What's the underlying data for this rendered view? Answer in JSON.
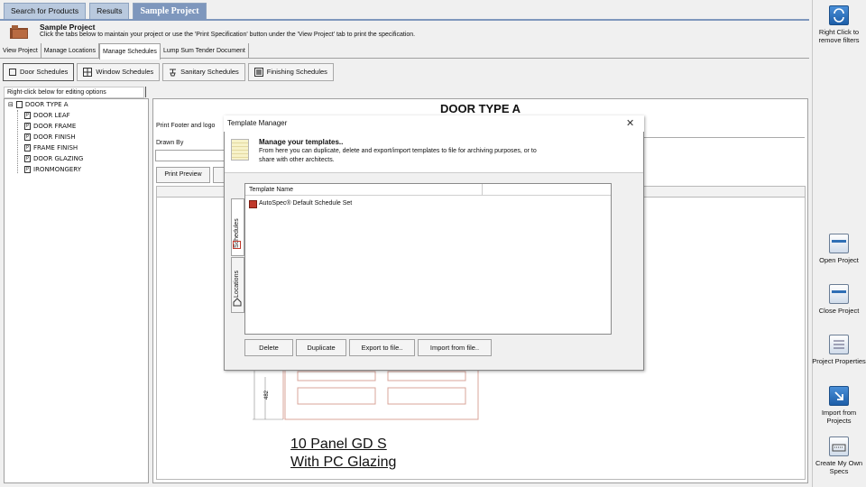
{
  "top_tabs": [
    "Search for Products",
    "Results",
    "Sample Project"
  ],
  "header": {
    "title": "Sample Project",
    "subtitle": "Click the tabs below to maintain your project or use the 'Print Specification' button under the 'View Project' tab to print the specification."
  },
  "sub_tabs": [
    "View Project",
    "Manage Locations",
    "Manage Schedules",
    "Lump Sum Tender Document"
  ],
  "schedule_buttons": [
    "Door Schedules",
    "Window Schedules",
    "Sanitary Schedules",
    "Finishing Schedules"
  ],
  "tree": {
    "hint": "Right-click below for editing options",
    "root": "DOOR TYPE A",
    "children": [
      "DOOR LEAF",
      "DOOR FRAME",
      "DOOR FINISH",
      "FRAME FINISH",
      "DOOR GLAZING",
      "IRONMONGERY"
    ]
  },
  "main": {
    "door_title": "DOOR TYPE A",
    "print_footer_label": "Print Footer and logo",
    "drawn_by_label": "Drawn By",
    "print_preview_label": "Print Preview",
    "dimension_label": "482",
    "caption_line1": "10 Panel GD S",
    "caption_line2": "With PC Glazing"
  },
  "right_panel": {
    "filter_label": "Right Click to remove filters",
    "buttons": [
      "Open Project",
      "Close Project",
      "Project Properties",
      "Import from Projects",
      "Create My Own Specs"
    ]
  },
  "dialog": {
    "title": "Template Manager",
    "close": "✕",
    "heading": "Manage your templates..",
    "desc_line1": "From here you can duplicate, delete and export/import templates to file for archiving purposes, or to",
    "desc_line2": "share with other architects.",
    "side_tabs": [
      "Schedules",
      "Locations"
    ],
    "column_header": "Template Name",
    "rows": [
      "AutoSpec® Default Schedule Set"
    ],
    "buttons": [
      "Delete",
      "Duplicate",
      "Export to file..",
      "Import from file.."
    ]
  },
  "colors": {
    "tab_active": "#7e97bd",
    "tab_inactive": "#b9c9de",
    "drawing_line": "#d9a49a"
  }
}
